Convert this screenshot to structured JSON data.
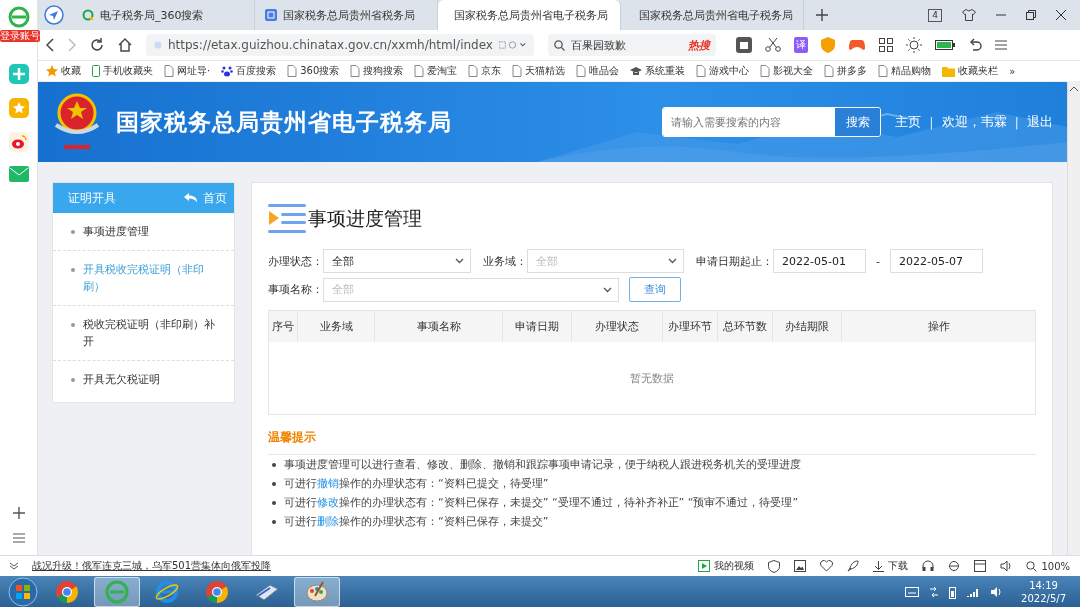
{
  "rail": {
    "badge": "登录账号"
  },
  "tabs": [
    {
      "title": "电子税务局_360搜索",
      "kind": "search",
      "selected": false
    },
    {
      "title": "国家税务总局贵州省税务局",
      "kind": "site",
      "selected": false
    },
    {
      "title": "国家税务总局贵州省电子税务局",
      "kind": "site",
      "selected": true
    },
    {
      "title": "国家税务总局贵州省电子税务局",
      "kind": "page",
      "selected": false
    }
  ],
  "tab_count": "4",
  "address": {
    "url": "https://etax.guizhou.chinatax.gov.cn/xxmh/html/index"
  },
  "browser_search": {
    "value": "百果园致歉",
    "hot": "热搜"
  },
  "translate_label": "译",
  "bookmarks": [
    {
      "label": "收藏",
      "kind": "star"
    },
    {
      "label": "手机收藏夹",
      "kind": "phone"
    },
    {
      "label": "网址导·",
      "kind": "page"
    },
    {
      "label": "百度搜索",
      "kind": "paw"
    },
    {
      "label": "360搜索",
      "kind": "page"
    },
    {
      "label": "搜狗搜索",
      "kind": "page"
    },
    {
      "label": "爱淘宝",
      "kind": "page"
    },
    {
      "label": "京东",
      "kind": "page"
    },
    {
      "label": "天猫精选",
      "kind": "page"
    },
    {
      "label": "唯品会",
      "kind": "page"
    },
    {
      "label": "系统重装",
      "kind": "cap"
    },
    {
      "label": "游戏中心",
      "kind": "page"
    },
    {
      "label": "影视大全",
      "kind": "page"
    },
    {
      "label": "拼多多",
      "kind": "page"
    },
    {
      "label": "精品购物",
      "kind": "page"
    },
    {
      "label": "收藏夹栏",
      "kind": "folder"
    },
    {
      "label": "»",
      "kind": "more"
    }
  ],
  "header": {
    "title": "国家税务总局贵州省电子税务局",
    "search_placeholder": "请输入需要搜索的内容",
    "search_button": "搜索",
    "links": [
      "主页",
      "欢迎，韦霖",
      "退出"
    ],
    "separator": "|"
  },
  "sidebar": {
    "title": "证明开具",
    "home": "首页",
    "items": [
      {
        "label": "事项进度管理",
        "selected": false
      },
      {
        "label": "开具税收完税证明（非印刷）",
        "selected": true
      },
      {
        "label": "税收完税证明（非印刷）补开",
        "selected": false
      },
      {
        "label": "开具无欠税证明",
        "selected": false
      }
    ]
  },
  "main": {
    "title": "事项进度管理",
    "filters": [
      {
        "label": "办理状态：",
        "value": "全部"
      },
      {
        "label": "业务域：",
        "placeholder": "全部"
      }
    ],
    "date_label": "申请日期起止：",
    "date_from": "2022-05-01",
    "date_sep": "-",
    "date_to": "2022-05-07",
    "name_filter": {
      "label": "事项名称：",
      "placeholder": "全部"
    },
    "query_button": "查询",
    "table": {
      "columns": [
        "序号",
        "业务域",
        "事项名称",
        "申请日期",
        "办理状态",
        "办理环节",
        "总环节数",
        "办结期限",
        "操作"
      ],
      "empty": "暂无数据"
    },
    "tips": {
      "title": "温馨提示",
      "lines": [
        {
          "text": "事项进度管理可以进行查看、修改、删除、撤销和跟踪事项申请记录，便于纳税人跟进税务机关的受理进度"
        },
        {
          "before": "可进行",
          "link": "撤销",
          "after": "操作的办理状态有：“资料已提交，待受理”"
        },
        {
          "before": "可进行",
          "link": "修改",
          "after": "操作的办理状态有：“资料已保存，未提交”  “受理不通过，待补齐补正”  “预审不通过，待受理”"
        },
        {
          "before": "可进行",
          "link": "删除",
          "after": "操作的办理状态有：“资料已保存，未提交”"
        }
      ]
    }
  },
  "status_bar": {
    "news": "战况升级！俄军连克三城，乌军501营集体向俄军投降",
    "video": "我的视频",
    "download": "下载",
    "zoom": "100%"
  },
  "taskbar": {
    "apps": [
      {
        "kind": "chrome",
        "active": false
      },
      {
        "kind": "browser-e",
        "active": true
      },
      {
        "kind": "ie",
        "active": false
      },
      {
        "kind": "chrome",
        "active": false
      },
      {
        "kind": "scanner",
        "active": false
      },
      {
        "kind": "paint",
        "active": true
      }
    ],
    "time": "14:19",
    "date": "2022/5/7"
  }
}
